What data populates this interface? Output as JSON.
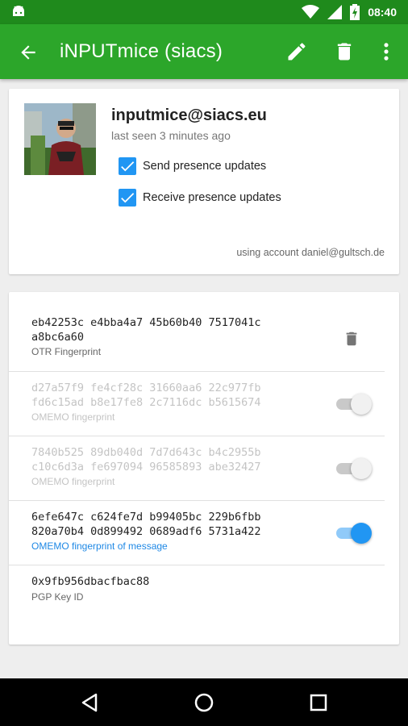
{
  "status_bar": {
    "time": "08:40",
    "icons": [
      "android-icon",
      "wifi-icon",
      "signal-icon",
      "battery-charging-icon"
    ]
  },
  "toolbar": {
    "title": "iNPUTmice (siacs)",
    "actions": [
      "back-arrow-icon",
      "edit-icon",
      "delete-icon",
      "overflow-menu-icon"
    ],
    "color": "#2ca62a"
  },
  "contact": {
    "jid": "inputmice@siacs.eu",
    "last_seen": "last seen 3 minutes ago",
    "send_presence_label": "Send presence updates",
    "send_presence_checked": true,
    "receive_presence_label": "Receive presence updates",
    "receive_presence_checked": true,
    "account": "using account daniel@gultsch.de"
  },
  "keys": [
    {
      "code": "eb42253c e4bba4a7 45b60b40 7517041c\na8bc6a60",
      "label": "OTR Fingerprint",
      "state": "delete"
    },
    {
      "code": "d27a57f9 fe4cf28c 31660aa6 22c977fb\nfd6c15ad b8e17fe8 2c7116dc b5615674",
      "label": "OMEMO fingerprint",
      "state": "off"
    },
    {
      "code": "7840b525 89db040d 7d7d643c b4c2955b\nc10c6d3a fe697094 96585893 abe32427",
      "label": "OMEMO fingerprint",
      "state": "off"
    },
    {
      "code": "6efe647c c624fe7d b99405bc 229b6fbb\n820a70b4 0d899492 0689adf6 5731a422",
      "label": "OMEMO fingerprint of message",
      "state": "on"
    },
    {
      "code": "0x9fb956dbacfbac88",
      "label": "PGP Key ID",
      "state": "none"
    }
  ],
  "accent_color": "#2196f3",
  "nav_bar": [
    "back-triangle-icon",
    "home-circle-icon",
    "recents-square-icon"
  ]
}
